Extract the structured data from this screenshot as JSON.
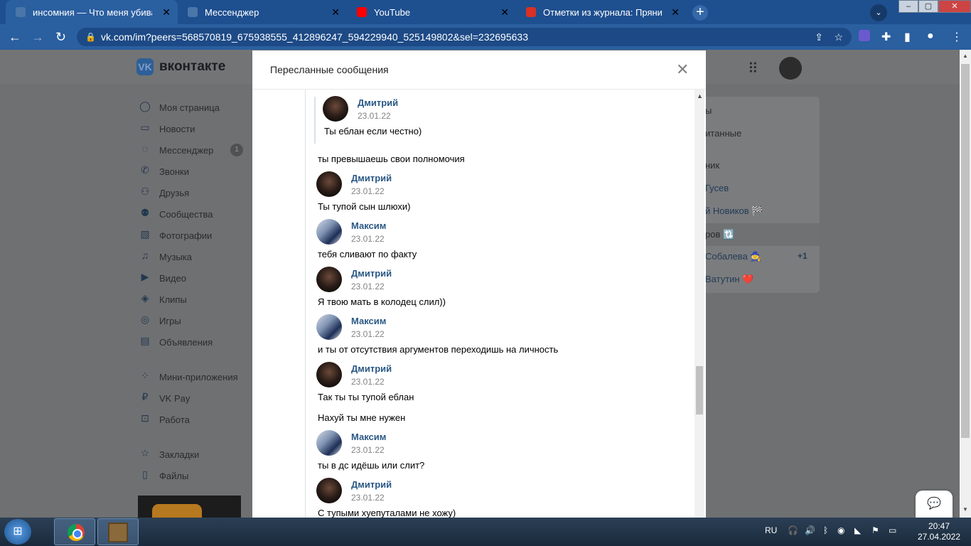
{
  "browser": {
    "tabs": [
      {
        "title": "инсомния — Что меня убивает?",
        "icon_color": "#4a76a8"
      },
      {
        "title": "Мессенджер",
        "icon_color": "#4a76a8"
      },
      {
        "title": "YouTube",
        "icon_color": "#ff0000"
      },
      {
        "title": "Отметки из журнала: Пряников",
        "icon_color": "#d93025"
      }
    ],
    "url": "vk.com/im?peers=568570819_675938555_412896247_594229940_525149802&sel=232695633"
  },
  "vk": {
    "logo": "вконтакте",
    "sidebar": [
      "Моя страница",
      "Новости",
      "Мессенджер",
      "Звонки",
      "Друзья",
      "Сообщества",
      "Фотографии",
      "Музыка",
      "Видео",
      "Клипы",
      "Игры",
      "Объявления",
      "Мини-приложения",
      "VK Pay",
      "Работа",
      "Закладки",
      "Файлы"
    ],
    "messenger_badge": "1",
    "right_panel": [
      "ы",
      "итанные",
      "ник",
      "Гусев",
      "й Новиков 🏁",
      "ров 🔃",
      "Собалева 🧙",
      "Ватутин ❤️"
    ],
    "right_plus": "+1"
  },
  "modal": {
    "title": "Пересланные сообщения",
    "quoted": {
      "name": "Дмитрий",
      "date": "23.01.22",
      "text": "Ты еблан если честно)"
    },
    "standalone": [
      "ты превышаешь свои полномочия",
      "Нахуй ты мне нужен"
    ],
    "messages": [
      {
        "name": "Дмитрий",
        "date": "23.01.22",
        "text": "Ты тупой сын шлюхи)",
        "avatar": "d"
      },
      {
        "name": "Максим",
        "date": "23.01.22",
        "text": "тебя сливают по факту",
        "avatar": "m"
      },
      {
        "name": "Дмитрий",
        "date": "23.01.22",
        "text": "Я твою мать в колодец слил))",
        "avatar": "d"
      },
      {
        "name": "Максим",
        "date": "23.01.22",
        "text": "и ты от отсутствия аргументов переходишь на личность",
        "avatar": "m"
      },
      {
        "name": "Дмитрий",
        "date": "23.01.22",
        "text": "Так ты ты тупой еблан",
        "avatar": "d"
      },
      {
        "name": "Максим",
        "date": "23.01.22",
        "text": "ты в дс идёшь или слит?",
        "avatar": "m"
      },
      {
        "name": "Дмитрий",
        "date": "23.01.22",
        "text": "С тупыми хуепуталами не хожу)",
        "avatar": "d"
      }
    ]
  },
  "taskbar": {
    "lang": "RU",
    "time": "20:47",
    "date": "27.04.2022"
  }
}
